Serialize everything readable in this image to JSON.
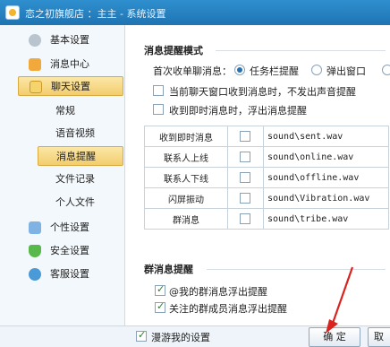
{
  "window": {
    "title": "恋之初旗舰店 ：主主 - 系统设置"
  },
  "sidebar": {
    "items": [
      {
        "label": "基本设置",
        "icon": "gear-icon"
      },
      {
        "label": "消息中心",
        "icon": "mail-icon"
      },
      {
        "label": "聊天设置",
        "icon": "chat-icon",
        "active": true
      },
      {
        "label": "个性设置",
        "icon": "card-icon"
      },
      {
        "label": "安全设置",
        "icon": "shield-icon"
      },
      {
        "label": "客服设置",
        "icon": "service-icon"
      }
    ],
    "subitems": [
      {
        "label": "常规"
      },
      {
        "label": "语音视频"
      },
      {
        "label": "消息提醒",
        "active": true
      },
      {
        "label": "文件记录"
      },
      {
        "label": "个人文件"
      }
    ]
  },
  "message_alert": {
    "section_title": "消息提醒模式",
    "first_message_label": "首次收单聊消息：",
    "radio_taskbar": "任务栏提醒",
    "radio_popup": "弹出窗口",
    "option_no_sound": "当前聊天窗口收到消息时，不发出声音提醒",
    "option_float": "收到即时消息时，浮出消息提醒"
  },
  "sound_table": {
    "rows": [
      {
        "event": "收到即时消息",
        "file": "sound\\sent.wav"
      },
      {
        "event": "联系人上线",
        "file": "sound\\online.wav"
      },
      {
        "event": "联系人下线",
        "file": "sound\\offline.wav"
      },
      {
        "event": "闪屏振动",
        "file": "sound\\Vibration.wav"
      },
      {
        "event": "群消息",
        "file": "sound\\tribe.wav"
      }
    ]
  },
  "group_alert": {
    "section_title": "群消息提醒",
    "option_at_me": "@我的群消息浮出提醒",
    "option_followed": "关注的群成员消息浮出提醒"
  },
  "footer": {
    "roam_label": "漫游我的设置",
    "ok_label": "确 定",
    "cancel_label": "取"
  },
  "colors": {
    "titlebar": "#1f74b3",
    "active_nav": "#f3cd6e",
    "arrow": "#d8231f"
  }
}
